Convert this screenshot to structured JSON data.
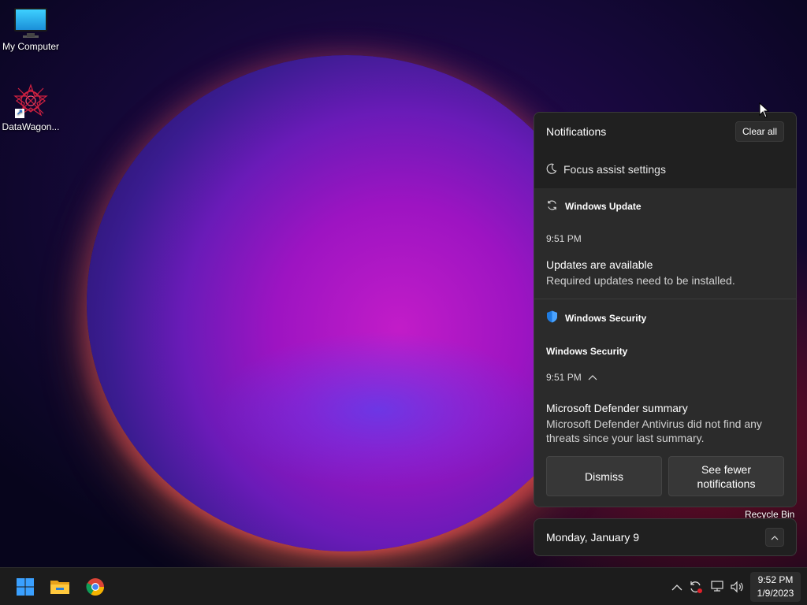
{
  "desktop": {
    "icons": [
      {
        "label": "My Computer",
        "icon": "monitor-icon"
      },
      {
        "label": "DataWagon...",
        "icon": "app-shortcut-icon"
      }
    ],
    "recycle_bin_label": "Recycle Bin"
  },
  "notifications": {
    "title": "Notifications",
    "clear_all": "Clear all",
    "focus_assist": "Focus assist settings",
    "items": [
      {
        "app": "Windows Update",
        "icon": "sync-icon",
        "time": "9:51 PM",
        "headline": "Updates are available",
        "body": "Required updates need to be installed."
      },
      {
        "app": "Windows Security",
        "icon": "shield-icon",
        "sender": "Windows Security",
        "time": "9:51 PM",
        "headline": "Microsoft Defender summary",
        "body": "Microsoft Defender Antivirus did not find any threats since your last summary.",
        "actions": [
          "Dismiss",
          "See fewer notifications"
        ]
      }
    ]
  },
  "calendar": {
    "date": "Monday, January 9"
  },
  "taskbar": {
    "pinned": [
      {
        "name": "Start",
        "icon": "windows-logo-icon"
      },
      {
        "name": "File Explorer",
        "icon": "folder-icon"
      },
      {
        "name": "Google Chrome",
        "icon": "chrome-icon"
      }
    ],
    "tray": [
      "chevron-up-icon",
      "update-sync-icon",
      "network-icon",
      "volume-icon"
    ],
    "clock": {
      "time": "9:52 PM",
      "date": "1/9/2023"
    }
  },
  "colors": {
    "panel_bg": "#202020",
    "card_bg": "#2b2b2b",
    "taskbar_bg": "#1c1c1c",
    "shield_blue": "#1f7be0"
  }
}
